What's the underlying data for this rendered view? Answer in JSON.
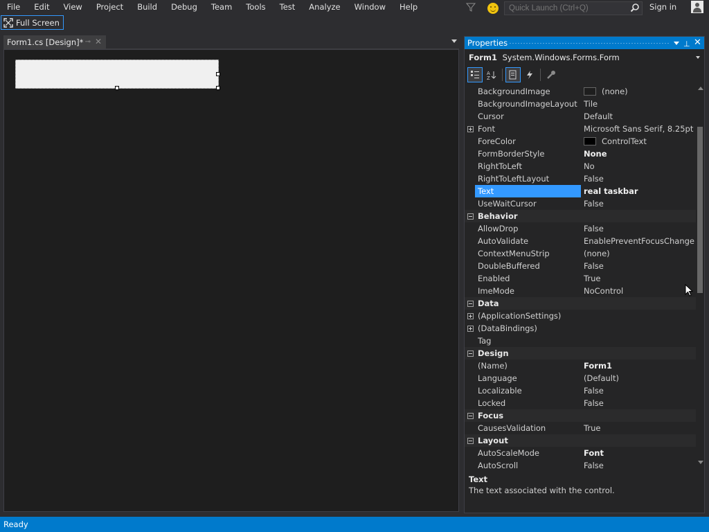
{
  "menu": [
    "File",
    "Edit",
    "View",
    "Project",
    "Build",
    "Debug",
    "Team",
    "Tools",
    "Test",
    "Analyze",
    "Window",
    "Help"
  ],
  "quick_launch": {
    "placeholder": "Quick Launch (Ctrl+Q)"
  },
  "sign_in": "Sign in",
  "toolbar": {
    "full_screen": "Full Screen"
  },
  "document_tab": {
    "label": "Form1.cs [Design]*"
  },
  "properties": {
    "title": "Properties",
    "object_name": "Form1",
    "object_type": "System.Windows.Forms.Form",
    "rows": [
      {
        "name": "BackgroundImage",
        "value": "(none)",
        "swatch": "#1e1e1e"
      },
      {
        "name": "BackgroundImageLayout",
        "value": "Tile"
      },
      {
        "name": "Cursor",
        "value": "Default"
      },
      {
        "name": "Font",
        "value": "Microsoft Sans Serif, 8.25pt",
        "expander": "plus"
      },
      {
        "name": "ForeColor",
        "value": "ControlText",
        "swatch": "#000000"
      },
      {
        "name": "FormBorderStyle",
        "value": "None",
        "bold": true
      },
      {
        "name": "RightToLeft",
        "value": "No"
      },
      {
        "name": "RightToLeftLayout",
        "value": "False"
      },
      {
        "name": "Text",
        "value": "real taskbar",
        "bold": true,
        "selected": true
      },
      {
        "name": "UseWaitCursor",
        "value": "False"
      },
      {
        "name": "Behavior",
        "category": true
      },
      {
        "name": "AllowDrop",
        "value": "False"
      },
      {
        "name": "AutoValidate",
        "value": "EnablePreventFocusChange"
      },
      {
        "name": "ContextMenuStrip",
        "value": "(none)"
      },
      {
        "name": "DoubleBuffered",
        "value": "False"
      },
      {
        "name": "Enabled",
        "value": "True"
      },
      {
        "name": "ImeMode",
        "value": "NoControl"
      },
      {
        "name": "Data",
        "category": true
      },
      {
        "name": "(ApplicationSettings)",
        "value": "",
        "expander": "plus"
      },
      {
        "name": "(DataBindings)",
        "value": "",
        "expander": "plus"
      },
      {
        "name": "Tag",
        "value": ""
      },
      {
        "name": "Design",
        "category": true
      },
      {
        "name": "(Name)",
        "value": "Form1",
        "bold": true
      },
      {
        "name": "Language",
        "value": "(Default)"
      },
      {
        "name": "Localizable",
        "value": "False"
      },
      {
        "name": "Locked",
        "value": "False"
      },
      {
        "name": "Focus",
        "category": true
      },
      {
        "name": "CausesValidation",
        "value": "True"
      },
      {
        "name": "Layout",
        "category": true
      },
      {
        "name": "AutoScaleMode",
        "value": "Font",
        "bold": true
      },
      {
        "name": "AutoScroll",
        "value": "False"
      }
    ],
    "description_title": "Text",
    "description_text": "The text associated with the control."
  },
  "status": "Ready",
  "colors": {
    "accent": "#007acc",
    "selection": "#3399ff"
  }
}
